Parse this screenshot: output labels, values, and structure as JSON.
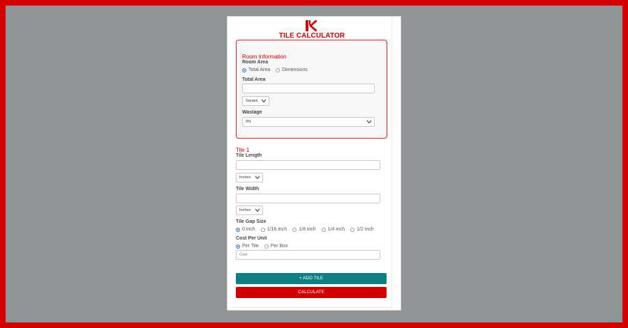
{
  "app": {
    "title": "TILE CALCULATOR",
    "logo_letter": "K",
    "brand_color": "#d10000"
  },
  "room": {
    "section_title": "Room Information",
    "room_area_label": "Room Area",
    "room_area_options": [
      "Total Area",
      "Dimensions"
    ],
    "room_area_selected": "Total Area",
    "total_area_label": "Total Area",
    "total_area_value": "",
    "area_unit_selected": "Square",
    "wastage_label": "Wastage",
    "wastage_selected": "0%"
  },
  "tile": {
    "section_title": "Tile 1",
    "length_label": "Tile Length",
    "length_value": "",
    "length_unit_selected": "Inches",
    "width_label": "Tile Width",
    "width_value": "",
    "width_unit_selected": "Inches",
    "gap_label": "Tile Gap Size",
    "gap_options": [
      "0 inch",
      "1/16 inch",
      "1/8 inch",
      "1/4 inch",
      "1/2 inch"
    ],
    "gap_selected": "0 inch",
    "cost_label": "Cost Per Unit",
    "cost_options": [
      "Per Tile",
      "Per Box"
    ],
    "cost_selected": "Per Tile",
    "cost_placeholder": "Cost"
  },
  "actions": {
    "add_tile_label": "+ ADD TILE",
    "calculate_label": "CALCULATE",
    "add_tile_color": "#0f7f84",
    "calculate_color": "#d10000"
  }
}
